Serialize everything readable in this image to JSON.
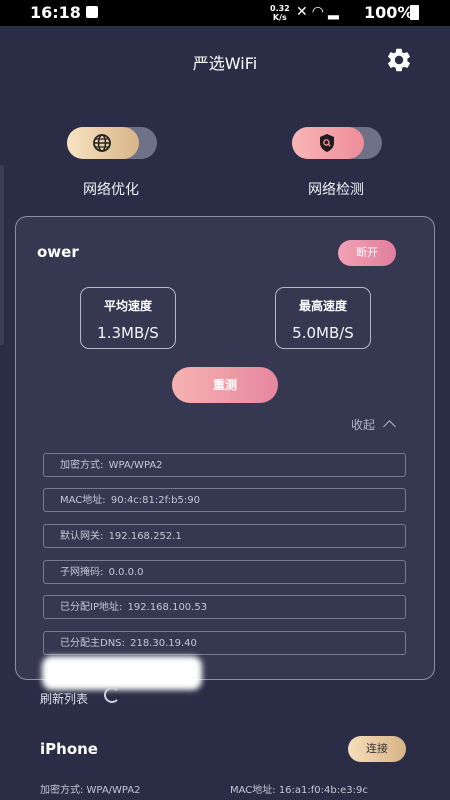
{
  "status_bar": {
    "time": "16:18",
    "net_speed_value": "0.32",
    "net_speed_unit": "K/s",
    "battery": "100%"
  },
  "header": {
    "title": "严选WiFi",
    "settings_icon": "gear-icon"
  },
  "toggles": [
    {
      "label": "网络优化",
      "icon": "globe-icon"
    },
    {
      "label": "网络检测",
      "icon": "shield-search-icon"
    }
  ],
  "current_network": {
    "name": "ower",
    "disconnect_label": "断开",
    "avg_speed_label": "平均速度",
    "avg_speed_value": "1.3MB/S",
    "max_speed_label": "最高速度",
    "max_speed_value": "5.0MB/S",
    "retest_label": "重测",
    "collapse_label": "收起",
    "details": [
      {
        "label": "加密方式:",
        "value": "WPA/WPA2"
      },
      {
        "label": "MAC地址:",
        "value": "90:4c:81:2f:b5:90"
      },
      {
        "label": "默认网关:",
        "value": "192.168.252.1"
      },
      {
        "label": "子网掩码:",
        "value": "0.0.0.0"
      },
      {
        "label": "已分配IP地址:",
        "value": "192.168.100.53"
      },
      {
        "label": "已分配主DNS:",
        "value": "218.30.19.40"
      }
    ]
  },
  "refresh_label": "刷新列表",
  "networks": [
    {
      "name": "iPhone",
      "connect_label": "连接",
      "encryption": "加密方式: WPA/WPA2",
      "mac": "MAC地址: 16:a1:f0:4b:e3:9c"
    }
  ],
  "colors": {
    "background": "#2a2d45",
    "card": "#353850",
    "accent_pink": "#e5879f",
    "accent_gold": "#d9b487"
  }
}
